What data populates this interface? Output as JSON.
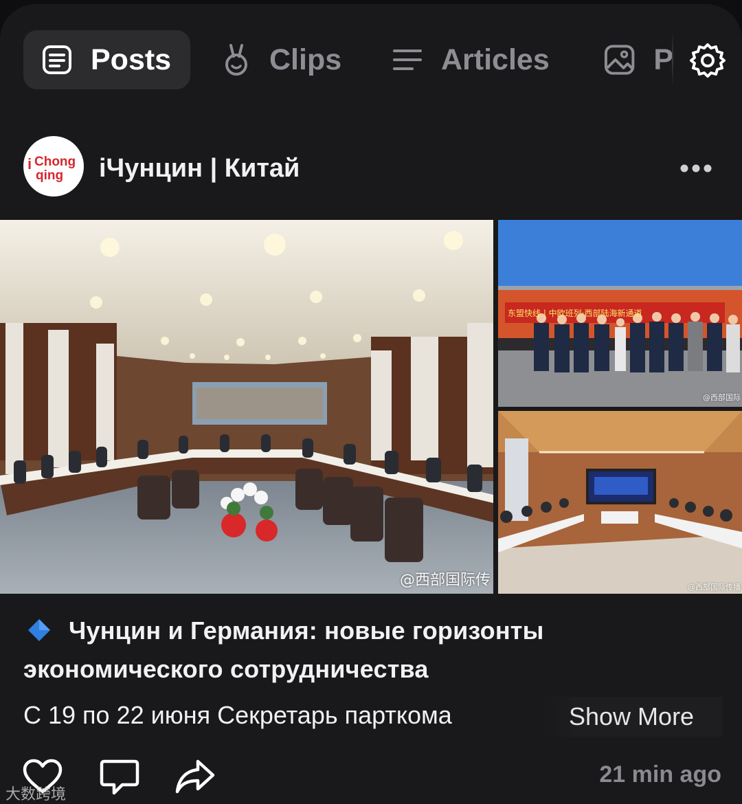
{
  "tabs": {
    "items": [
      {
        "label": "Posts",
        "icon": "document-icon",
        "active": true
      },
      {
        "label": "Clips",
        "icon": "clips-icon",
        "active": false
      },
      {
        "label": "Articles",
        "icon": "menu-lines-icon",
        "active": false
      },
      {
        "label": "P",
        "icon": "image-icon",
        "active": false
      }
    ],
    "settings_icon": "gear-icon"
  },
  "post": {
    "author": "iЧунцин | Китай",
    "avatar_text": [
      "i",
      "Chong",
      "qing"
    ],
    "more_icon": "ellipsis-icon",
    "images": {
      "main_watermark": "@西部国际传",
      "top_watermark": "@西部国际",
      "bottom_watermark": "@西部国际传播",
      "train_banner": "东盟快线 | 中欧班列·西部陆海新通道"
    },
    "title": "Чунцин и Германия: новые горизонты экономического сотрудничества",
    "body": "С 19 по 22 июня Секретарь парткома",
    "show_more": "Show More",
    "time_ago": "21 min ago",
    "actions": [
      "heart-icon",
      "comment-icon",
      "share-icon"
    ]
  },
  "corner_watermark": "大数跨境",
  "colors": {
    "background": "#19191b",
    "active_tab": "#2c2c2f",
    "muted": "#8d8d93",
    "accent_diamond": "#2f7fe0"
  }
}
